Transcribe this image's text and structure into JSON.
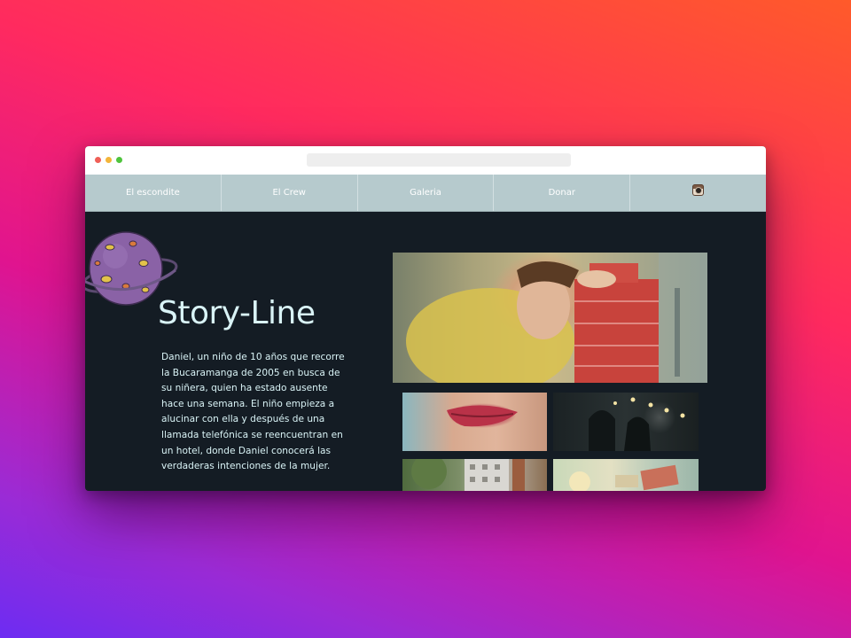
{
  "nav": {
    "items": [
      {
        "label": "El escondite"
      },
      {
        "label": "El Crew"
      },
      {
        "label": "Galeria"
      },
      {
        "label": "Donar"
      }
    ],
    "instagram_icon": "instagram-icon"
  },
  "main": {
    "title": "Story-Line",
    "synopsis": "Daniel, un niño de 10 años que recorre la Bucaramanga de 2005 en busca de su niñera, quien ha estado ausente hace una semana. El niño empieza a alucinar con ella y después de una llamada telefónica se reencuentran en un hotel, donde Daniel conocerá las verdaderas intenciones de la mujer."
  },
  "colors": {
    "background": "#141c24",
    "nav": "#b6cacd",
    "text": "#d9f3f6",
    "planet": "#8a62a6"
  }
}
